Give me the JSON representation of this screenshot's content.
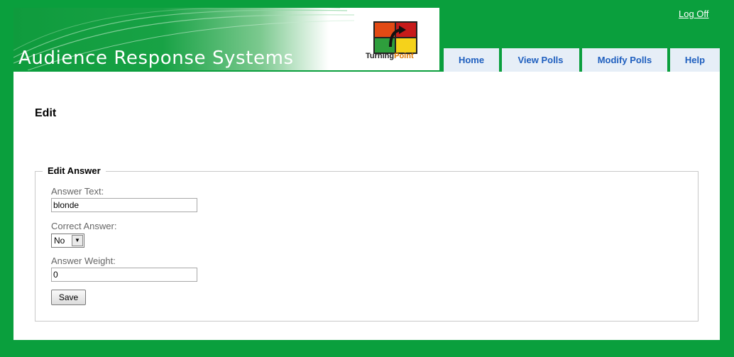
{
  "header": {
    "banner_title": "Audience Response Systems",
    "logo_text_turning": "Turning",
    "logo_text_point": "Point",
    "logoff_label": "Log Off"
  },
  "nav": {
    "tabs": [
      {
        "label": "Home"
      },
      {
        "label": "View Polls"
      },
      {
        "label": "Modify Polls"
      },
      {
        "label": "Help"
      }
    ]
  },
  "main": {
    "page_title": "Edit",
    "form": {
      "legend": "Edit Answer",
      "answer_text_label": "Answer Text:",
      "answer_text_value": "blonde",
      "correct_answer_label": "Correct Answer:",
      "correct_answer_value": "No",
      "answer_weight_label": "Answer Weight:",
      "answer_weight_value": "0",
      "save_label": "Save"
    }
  },
  "colors": {
    "background": "#0a9f3d",
    "tab_background": "#e6eef7",
    "tab_text": "#1f5fbf",
    "logo_point": "#e07b00"
  }
}
